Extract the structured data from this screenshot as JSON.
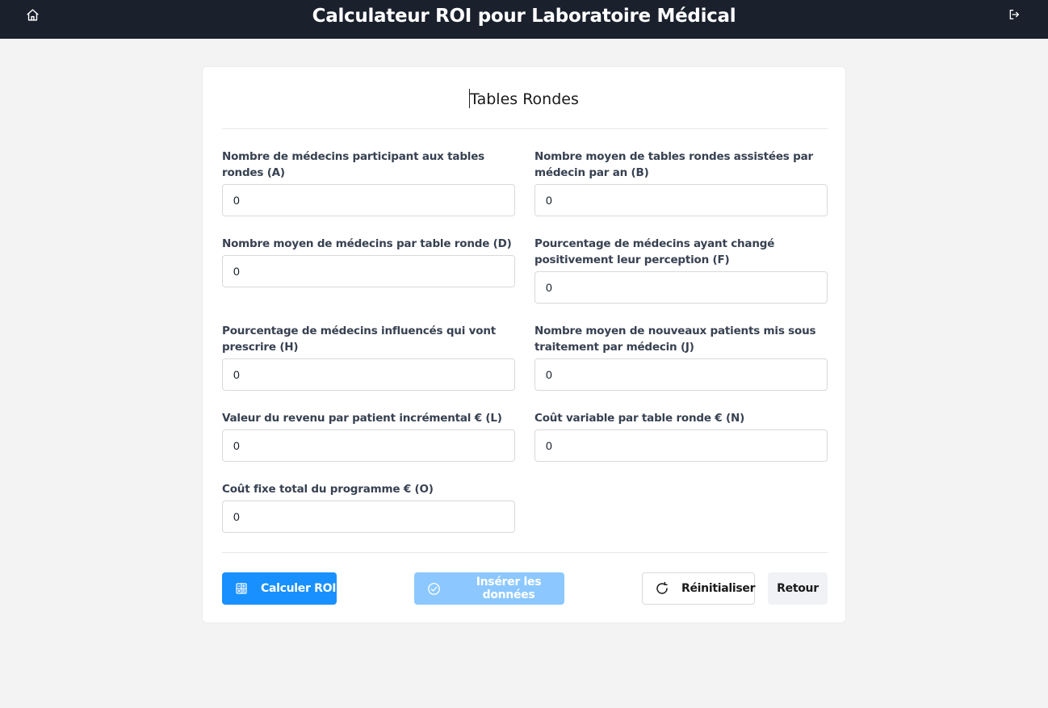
{
  "header": {
    "title": "Calculateur ROI pour Laboratoire Médical",
    "home_icon": "home-icon",
    "logout_icon": "logout-icon"
  },
  "card": {
    "title": "Tables Rondes"
  },
  "fields": [
    {
      "label": "Nombre de médecins participant aux tables rondes (A)",
      "value": "0"
    },
    {
      "label": "Nombre moyen de tables rondes assistées par médecin par an (B)",
      "value": "0"
    },
    {
      "label": "Nombre moyen de médecins par table ronde (D)",
      "value": "0"
    },
    {
      "label": "Pourcentage de médecins ayant changé positivement leur perception (F)",
      "value": "0"
    },
    {
      "label": "Pourcentage de médecins influencés qui vont prescrire (H)",
      "value": "0"
    },
    {
      "label": "Nombre moyen de nouveaux patients mis sous traitement par médecin (J)",
      "value": "0"
    },
    {
      "label": "Valeur du revenu par patient incrémental € (L)",
      "value": "0"
    },
    {
      "label": "Coût variable par table ronde € (N)",
      "value": "0"
    },
    {
      "label": "Coût fixe total du programme € (O)",
      "value": "0"
    }
  ],
  "actions": {
    "calculate": {
      "label": "Calculer ROI",
      "icon": "calculator-icon"
    },
    "insert": {
      "label": "Insérer les données",
      "icon": "check-circle-icon",
      "disabled": true
    },
    "reset": {
      "label": "Réinitialiser",
      "icon": "reload-icon"
    },
    "back": {
      "label": "Retour"
    }
  },
  "colors": {
    "topbar": "#1a202c",
    "primary": "#1890ff",
    "primary_disabled": "#8cc8ff",
    "background": "#f3f3f3"
  }
}
